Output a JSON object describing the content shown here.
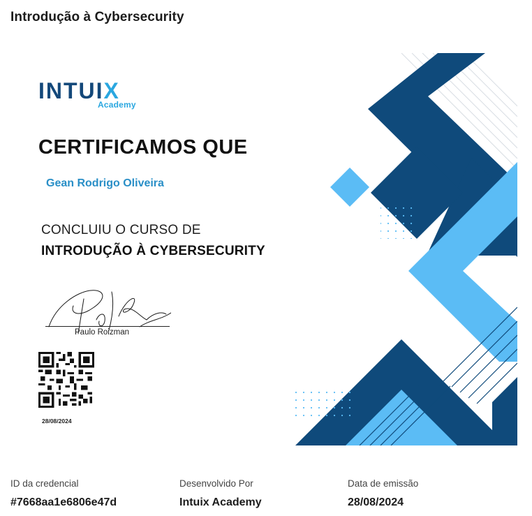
{
  "page": {
    "title": "Introdução à Cybersecurity"
  },
  "certificate": {
    "logo_main": "INTUI",
    "logo_accent": "X",
    "logo_sub": "Academy",
    "heading": "CERTIFICAMOS QUE",
    "recipient": "Gean Rodrigo Oliveira",
    "course_intro": "CONCLUIU O CURSO DE",
    "course_name": "INTRODUÇÃO À CYBERSECURITY",
    "signer": "Paulo Roizman",
    "issue_date": "28/08/2024",
    "colors": {
      "navy": "#0f4a7b",
      "light_blue": "#5bbcf5",
      "text_blue": "#2a8fc7"
    }
  },
  "details": {
    "credential_label": "ID da credencial",
    "credential_value": "#7668aa1e6806e47d",
    "developer_label": "Desenvolvido Por",
    "developer_value": "Intuix Academy",
    "issue_label": "Data de emissão",
    "issue_value": "28/08/2024"
  }
}
